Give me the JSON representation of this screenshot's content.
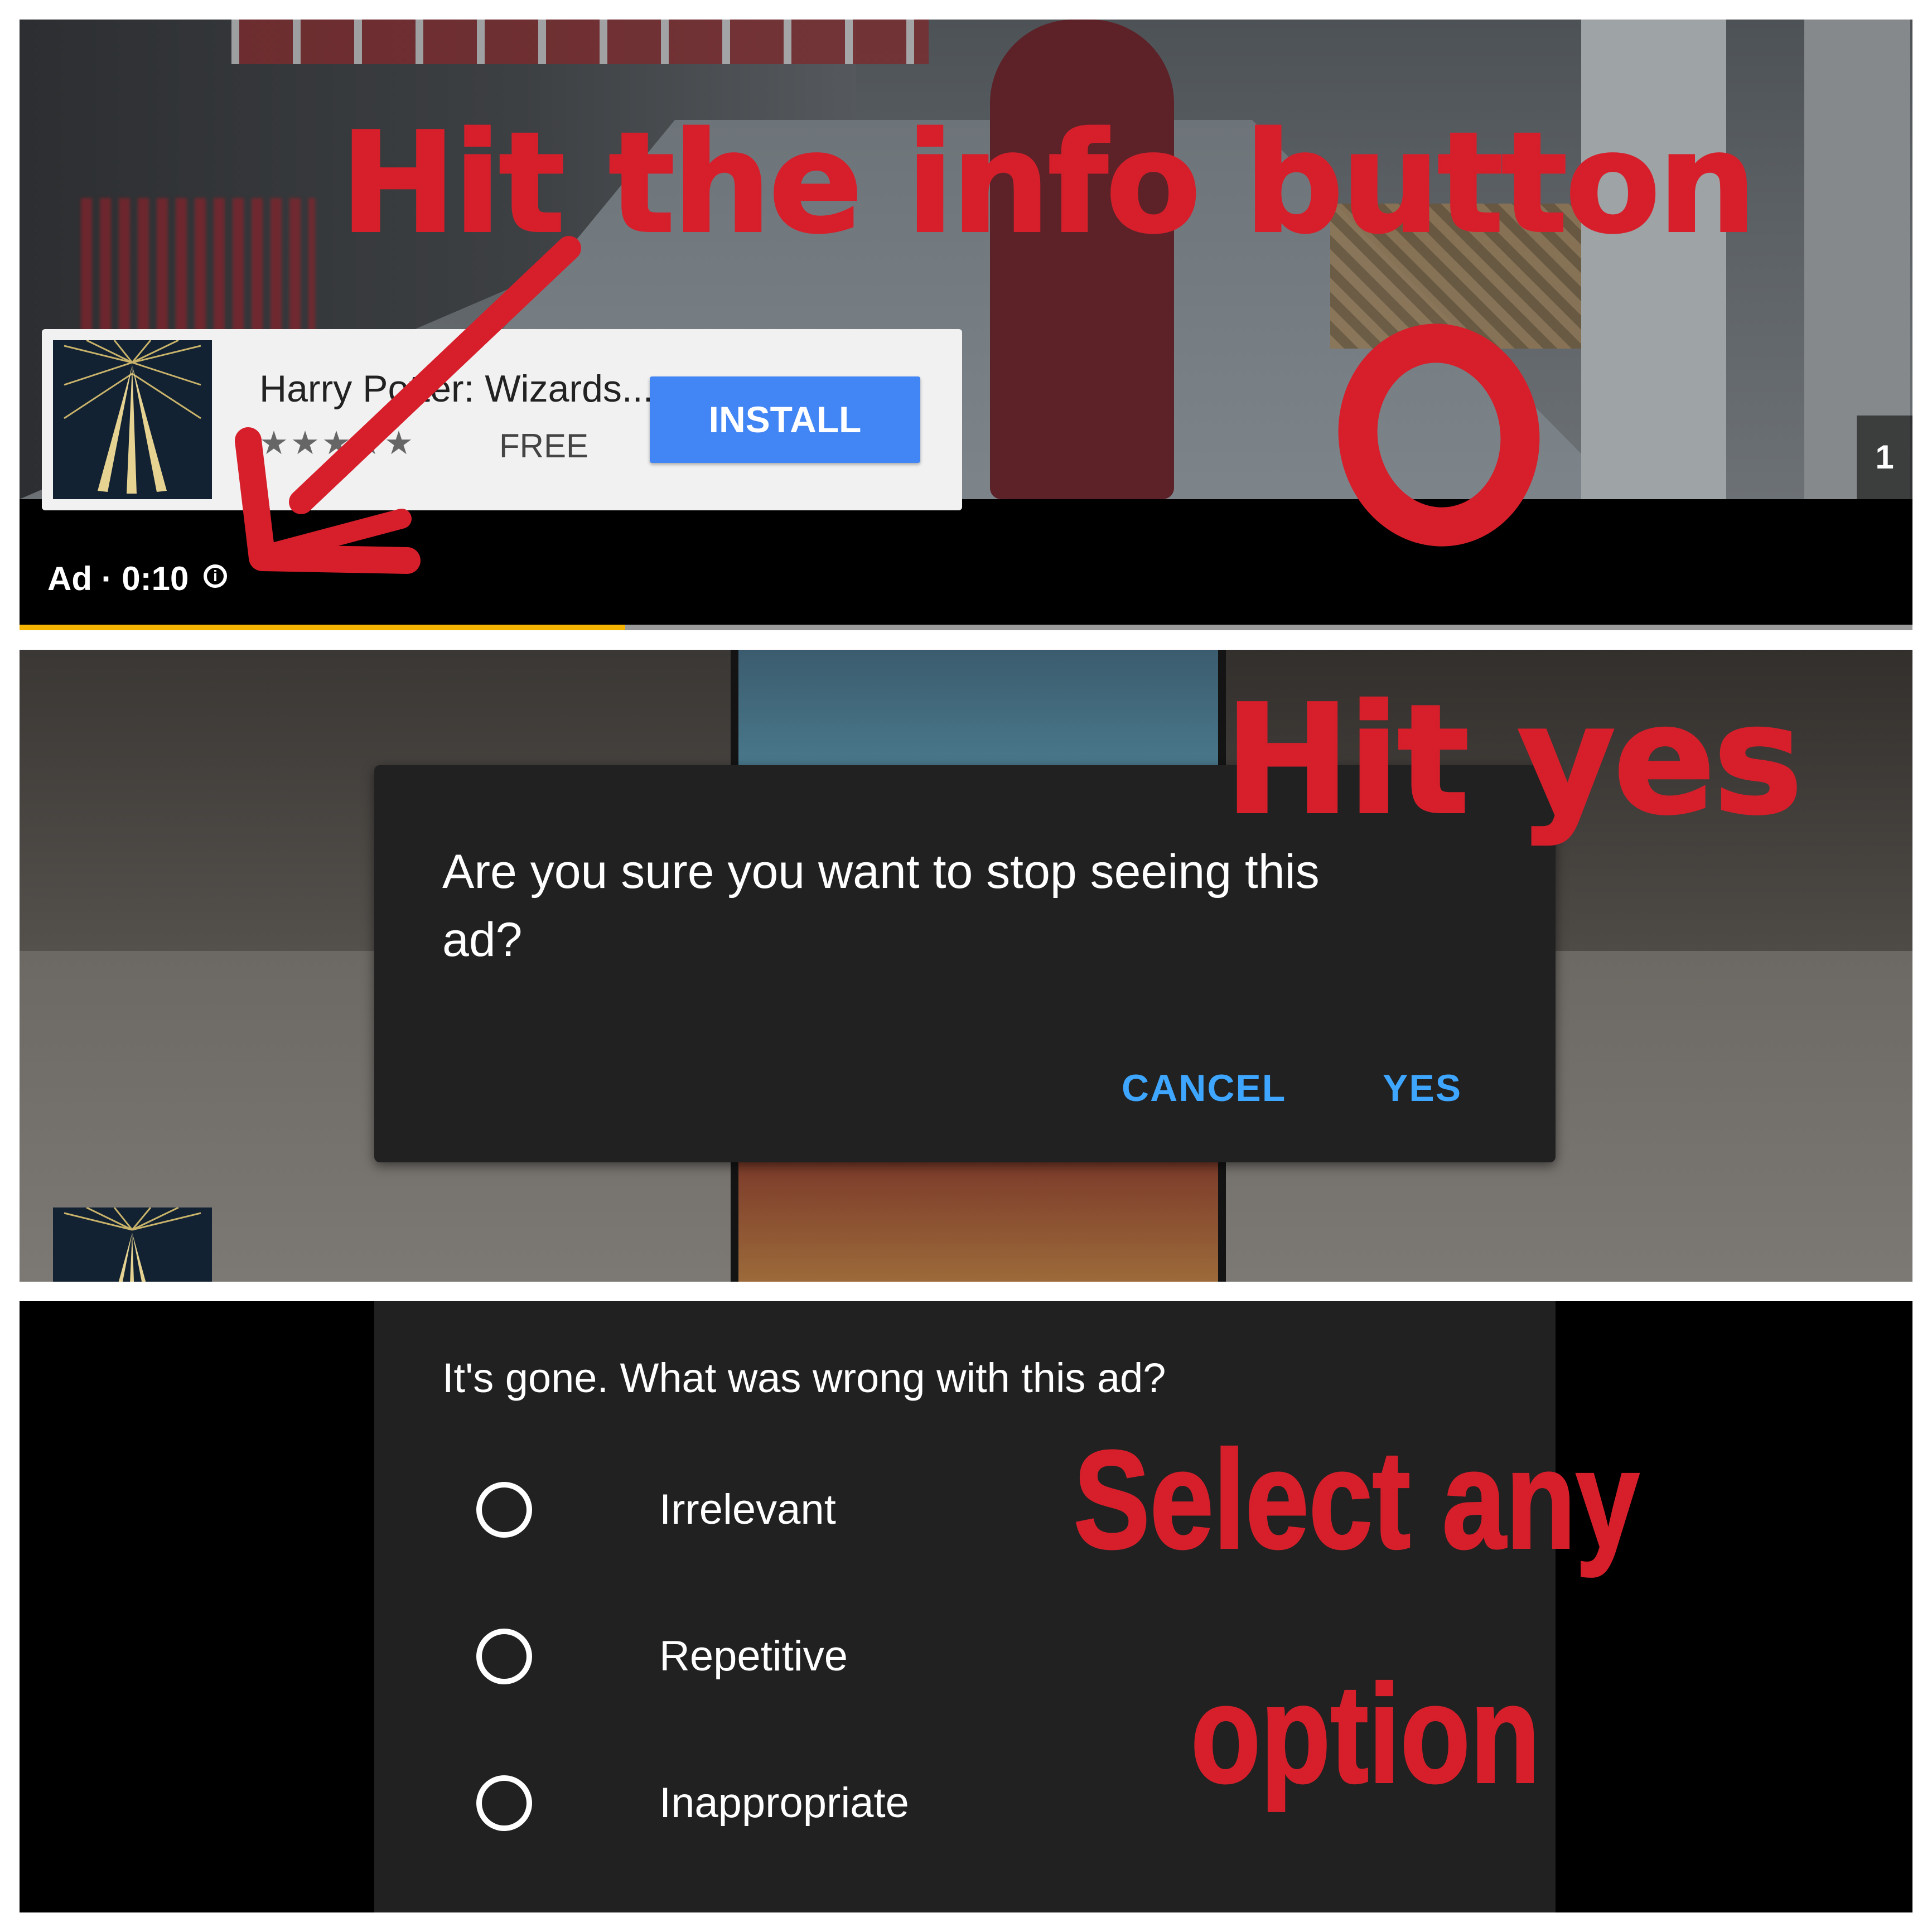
{
  "panel1": {
    "ad_card": {
      "title": "Harry Potter: Wizards...",
      "rating_stars": "★★★★★",
      "price": "FREE",
      "install_label": "INSTALL"
    },
    "ad_time": "Ad · 0:10",
    "info_icon": "info-icon",
    "counter": "1",
    "progress": 0.32,
    "progress_color": "#f4b400"
  },
  "panel2": {
    "dialog": {
      "message": "Are you sure you want to stop seeing this ad?",
      "cancel_label": "CANCEL",
      "yes_label": "YES",
      "button_color": "#3ea6ff"
    }
  },
  "panel3": {
    "question": "It's gone. What was wrong with this ad?",
    "options": [
      {
        "label": "Irrelevant"
      },
      {
        "label": "Repetitive"
      },
      {
        "label": "Inappropriate"
      }
    ]
  },
  "annotations": {
    "step1": "Hit the info button",
    "step2": "Hit yes",
    "step3_line1": "Select any",
    "step3_line2": "option",
    "color": "#d61f2b"
  }
}
